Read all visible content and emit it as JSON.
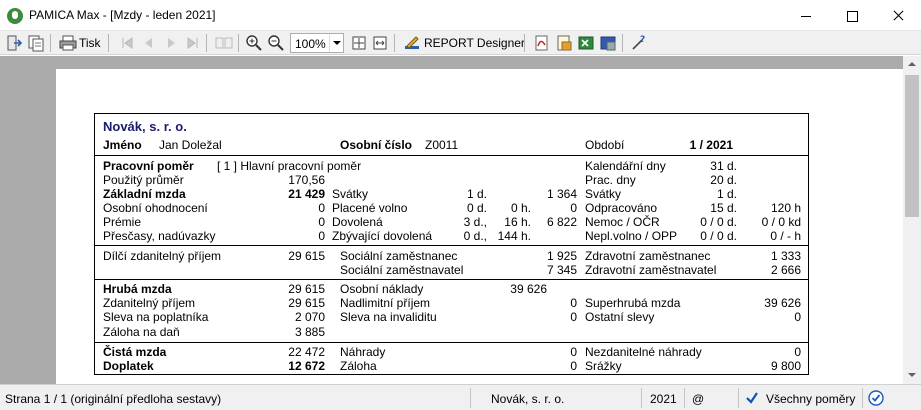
{
  "window": {
    "title": "PAMICA Max - [Mzdy - leden 2021]"
  },
  "toolbar": {
    "print_label": "Tisk",
    "zoom_value": "100%",
    "report_designer_label": "REPORT Designer"
  },
  "report": {
    "company": "Novák, s. r. o.",
    "header": {
      "name_label": "Jméno",
      "name_value": "Jan Doležal",
      "personal_no_label": "Osobní číslo",
      "personal_no_value": "Z0011",
      "period_label": "Období",
      "period_value": "1 / 2021"
    },
    "rows": {
      "employment_label": "Pracovní poměr",
      "employment_value": "[ 1 ]  Hlavní pracovní poměr",
      "used_avg_label": "Použitý průměr",
      "used_avg_value": "170,56",
      "base_wage_label": "Základní mzda",
      "base_wage_value": "21 429",
      "personal_eval_label": "Osobní ohodnocení",
      "personal_eval_value": "0",
      "bonus_label": "Prémie",
      "bonus_value": "0",
      "overtime_label": "Přesčasy, nadúvazky",
      "overtime_value": "0",
      "holidays_label": "Svátky",
      "holidays_days": "1 d.",
      "holidays_amount": "1 364",
      "paid_leave_label": "Placené volno",
      "paid_leave_days": "0 d.",
      "paid_leave_hours": "0 h.",
      "paid_leave_amount": "0",
      "vacation_label": "Dovolená",
      "vacation_days": "3 d.,",
      "vacation_hours": "16 h.",
      "vacation_amount": "6 822",
      "remaining_vac_label": "Zbývající dovolená",
      "remaining_vac_days": "0 d.,",
      "remaining_vac_hours": "144 h.",
      "cal_days_label": "Kalendářní dny",
      "cal_days_value": "31 d.",
      "work_days_label": "Prac. dny",
      "work_days_value": "20 d.",
      "holidays2_label": "Svátky",
      "holidays2_value": "1 d.",
      "worked_label": "Odpracováno",
      "worked_days": "15 d.",
      "worked_hours": "120 h",
      "sick_label": "Nemoc / OČR",
      "sick_days": "0 / 0 d.",
      "sick_kd": "0 / 0 kd",
      "unpaid_label": "Nepl.volno / OPP",
      "unpaid_days": "0 / 0 d.",
      "unpaid_hours": "0 / - h"
    },
    "insurance": {
      "partial_base_label": "Dílčí zdanitelný příjem",
      "partial_base_value": "29 615",
      "social_emp_label": "Sociální zaměstnanec",
      "social_emp_value": "1 925",
      "social_er_label": "Sociální zaměstnavatel",
      "social_er_value": "7 345",
      "health_emp_label": "Zdravotní zaměstnanec",
      "health_emp_value": "1 333",
      "health_er_label": "Zdravotní zaměstnavatel",
      "health_er_value": "2 666"
    },
    "gross": {
      "gross_wage_label": "Hrubá mzda",
      "gross_wage_value": "29 615",
      "taxable_label": "Zdanitelný příjem",
      "taxable_value": "29 615",
      "discount_label": "Sleva na poplatníka",
      "discount_value": "2 070",
      "advance_tax_label": "Záloha na daň",
      "advance_tax_value": "3 885",
      "personal_costs_label": "Osobní náklady",
      "personal_costs_value": "39 626",
      "over_limit_label": "Nadlimitní příjem",
      "over_limit_value": "0",
      "disability_label": "Sleva na invaliditu",
      "disability_value": "0",
      "supergross_label": "Superhrubá mzda",
      "supergross_value": "39 626",
      "other_discounts_label": "Ostatní slevy",
      "other_discounts_value": "0"
    },
    "net": {
      "net_wage_label": "Čistá mzda",
      "net_wage_value": "22 472",
      "payout_label": "Doplatek",
      "payout_value": "12 672",
      "compensation_label": "Náhrady",
      "compensation_value": "0",
      "advance_label": "Záloha",
      "advance_value": "0",
      "nontax_comp_label": "Nezdanitelné náhrady",
      "nontax_comp_value": "0",
      "deductions_label": "Srážky",
      "deductions_value": "9 800"
    }
  },
  "statusbar": {
    "page_info": "Strana 1 / 1  (originální předloha sestavy)",
    "company": "Novák, s. r. o.",
    "year": "2021",
    "at_symbol": "@",
    "filter": "Všechny poměry"
  }
}
